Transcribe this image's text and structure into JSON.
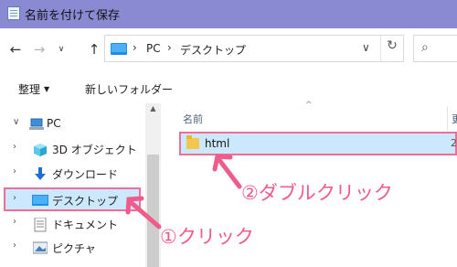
{
  "window": {
    "title": "名前を付けて保存"
  },
  "nav": {
    "back": "←",
    "forward": "→",
    "dropdown": "∨",
    "up": "↑"
  },
  "address": {
    "segments": [
      "PC",
      "デスクトップ"
    ],
    "separator": "›",
    "dropdown": "∨",
    "refresh": "↻"
  },
  "search": {
    "icon": "⌕"
  },
  "commandbar": {
    "organize": "整理",
    "organize_caret": "▼",
    "new_folder": "新しいフォルダー"
  },
  "sidebar": {
    "items": [
      {
        "chevron": "∨",
        "label": "PC",
        "icon": "pc-icon"
      },
      {
        "chevron": "›",
        "label": "3D オブジェクト",
        "icon": "3d-objects-icon"
      },
      {
        "chevron": "›",
        "label": "ダウンロード",
        "icon": "download-icon"
      },
      {
        "chevron": "›",
        "label": "デスクトップ",
        "icon": "desktop-icon",
        "selected": true
      },
      {
        "chevron": "›",
        "label": "ドキュメント",
        "icon": "document-icon"
      },
      {
        "chevron": "›",
        "label": "ピクチャ",
        "icon": "pictures-icon"
      }
    ]
  },
  "filelist": {
    "sort_indicator": "^",
    "columns": [
      "名前",
      "更"
    ],
    "files": [
      {
        "name": "html",
        "extra": "2"
      }
    ]
  },
  "annotations": {
    "step1": "①クリック",
    "step2": "②ダブルクリック",
    "color": "#ef5b8a"
  }
}
